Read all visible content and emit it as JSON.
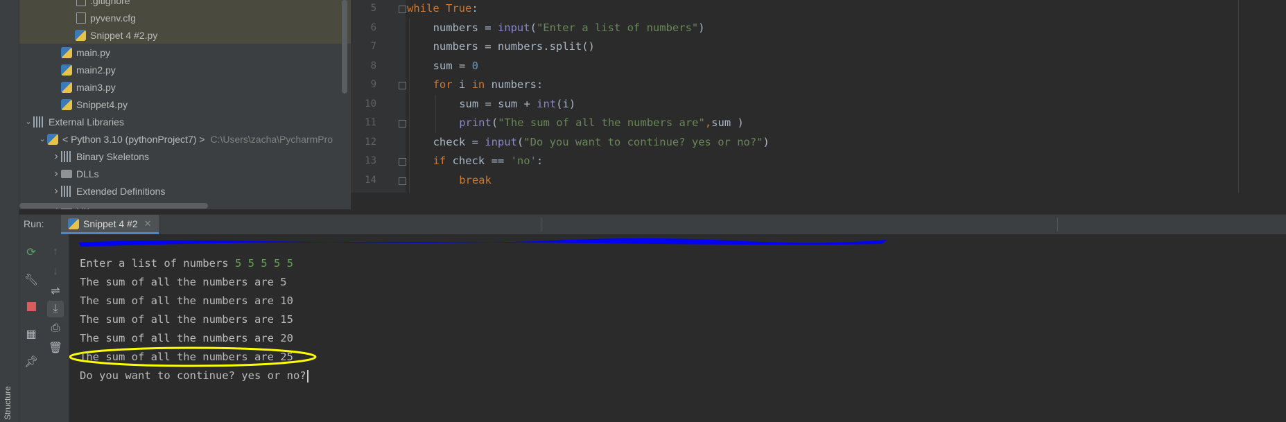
{
  "tool_strip": {
    "structure_label": "Structure"
  },
  "project_tree": {
    "items": [
      {
        "name": ".gitignore",
        "indent": 3,
        "icon": "file-icon",
        "hl": true
      },
      {
        "name": "pyvenv.cfg",
        "indent": 3,
        "icon": "file-icon",
        "hl": true
      },
      {
        "name": "Snippet 4 #2.py",
        "indent": 3,
        "icon": "python-file-icon",
        "hl": true
      },
      {
        "name": "main.py",
        "indent": 2,
        "icon": "python-file-icon",
        "hl": false
      },
      {
        "name": "main2.py",
        "indent": 2,
        "icon": "python-file-icon",
        "hl": false
      },
      {
        "name": "main3.py",
        "indent": 2,
        "icon": "python-file-icon",
        "hl": false
      },
      {
        "name": "Snippet4.py",
        "indent": 2,
        "icon": "python-file-icon",
        "hl": false
      },
      {
        "name": "External Libraries",
        "indent": 0,
        "icon": "library-icon",
        "arrow": "open",
        "hl": false
      },
      {
        "name": "< Python 3.10 (pythonProject7) >",
        "path": "C:\\Users\\zacha\\PycharmPro",
        "indent": 1,
        "icon": "python-sdk-icon",
        "arrow": "open",
        "hl": false
      },
      {
        "name": "Binary Skeletons",
        "indent": 2,
        "icon": "library-icon",
        "arrow": "closed",
        "hl": false
      },
      {
        "name": "DLLs",
        "indent": 2,
        "icon": "folder-icon",
        "arrow": "closed",
        "hl": false
      },
      {
        "name": "Extended Definitions",
        "indent": 2,
        "icon": "library-icon",
        "arrow": "closed",
        "hl": false
      },
      {
        "name": "Lib",
        "indent": 2,
        "icon": "folder-icon",
        "arrow": "closed",
        "hl": false
      }
    ]
  },
  "editor": {
    "lines": [
      {
        "n": "5",
        "fold": true,
        "indent": 0,
        "tokens": [
          [
            "kw",
            "while "
          ],
          [
            "kw",
            "True"
          ],
          [
            "p",
            ":"
          ]
        ]
      },
      {
        "n": "6",
        "indent": 1,
        "tokens": [
          [
            "p",
            "numbers = "
          ],
          [
            "fn",
            "input"
          ],
          [
            "p",
            "("
          ],
          [
            "str",
            "\"Enter a list of numbers\""
          ],
          [
            "p",
            ")"
          ]
        ]
      },
      {
        "n": "7",
        "indent": 1,
        "tokens": [
          [
            "p",
            "numbers = numbers.split()"
          ]
        ]
      },
      {
        "n": "8",
        "indent": 1,
        "tokens": [
          [
            "p",
            "sum = "
          ],
          [
            "num",
            "0"
          ]
        ]
      },
      {
        "n": "9",
        "fold": true,
        "indent": 1,
        "tokens": [
          [
            "kw",
            "for "
          ],
          [
            "p",
            "i "
          ],
          [
            "kw",
            "in "
          ],
          [
            "p",
            "numbers:"
          ]
        ]
      },
      {
        "n": "10",
        "indent": 2,
        "tokens": [
          [
            "p",
            "sum = sum + "
          ],
          [
            "fn",
            "int"
          ],
          [
            "p",
            "(i)"
          ]
        ]
      },
      {
        "n": "11",
        "fold": true,
        "indent": 2,
        "tokens": [
          [
            "fn",
            "print"
          ],
          [
            "p",
            "("
          ],
          [
            "str",
            "\"The sum of all the numbers are\""
          ],
          [
            "kw",
            ","
          ],
          [
            "p",
            "sum )"
          ]
        ]
      },
      {
        "n": "12",
        "indent": 1,
        "tokens": [
          [
            "p",
            "check = "
          ],
          [
            "fn",
            "input"
          ],
          [
            "p",
            "("
          ],
          [
            "str",
            "\"Do you want to continue? yes or no?\""
          ],
          [
            "p",
            ")"
          ]
        ]
      },
      {
        "n": "13",
        "fold": true,
        "indent": 1,
        "tokens": [
          [
            "kw",
            "if "
          ],
          [
            "p",
            "check == "
          ],
          [
            "str",
            "'no'"
          ],
          [
            "p",
            ":"
          ]
        ]
      },
      {
        "n": "14",
        "fold": true,
        "indent": 2,
        "tokens": [
          [
            "kw",
            "break"
          ]
        ]
      }
    ]
  },
  "run_panel": {
    "label": "Run:",
    "tab_label": "Snippet 4 #2",
    "close_glyph": "✕"
  },
  "console": {
    "prompt": "Enter a list of numbers ",
    "user_input": "5 5 5 5 5",
    "outputs": [
      "The sum of all the numbers are 5",
      "The sum of all the numbers are 10",
      "The sum of all the numbers are 15",
      "The sum of all the numbers are 20",
      "The sum of all the numbers are 25"
    ],
    "final_prompt": "Do you want to continue? yes or no?"
  },
  "colors": {
    "keyword": "#cc7832",
    "builtin": "#8888c6",
    "string": "#6a8759",
    "number": "#6897bb",
    "console_input": "#62a352",
    "redaction_scribble": "#0000ff",
    "highlight_circle": "#ffff00"
  }
}
